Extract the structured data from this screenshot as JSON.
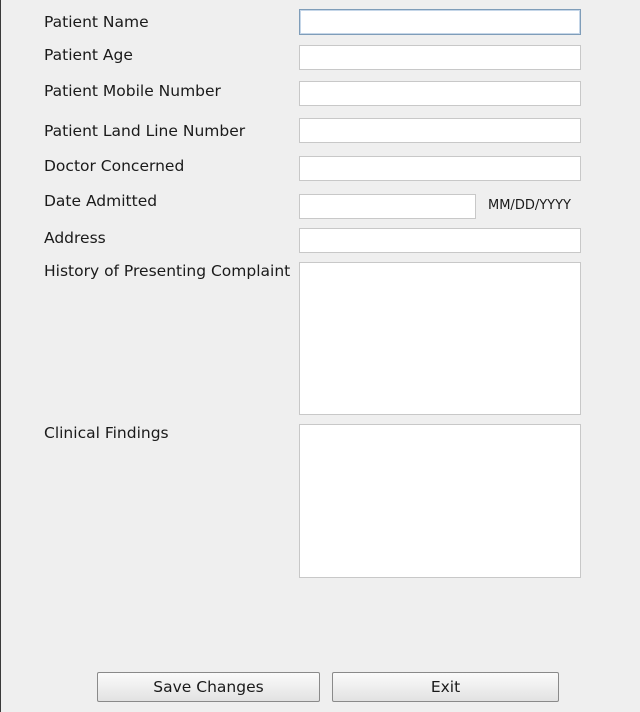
{
  "form": {
    "labels": {
      "patient_name": "Patient Name",
      "patient_age": "Patient Age",
      "patient_mobile": "Patient Mobile Number",
      "patient_landline": "Patient Land Line Number",
      "doctor": "Doctor Concerned",
      "date_admitted": "Date Admitted",
      "address": "Address",
      "history": "History of Presenting Complaint",
      "clinical_findings": "Clinical Findings"
    },
    "values": {
      "patient_name": "",
      "patient_age": "",
      "patient_mobile": "",
      "patient_landline": "",
      "doctor": "",
      "date_admitted": "",
      "address": "",
      "history": "",
      "clinical_findings": ""
    },
    "date_format_hint": "MM/DD/YYYY"
  },
  "buttons": {
    "save_label": "Save Changes",
    "exit_label": "Exit"
  }
}
